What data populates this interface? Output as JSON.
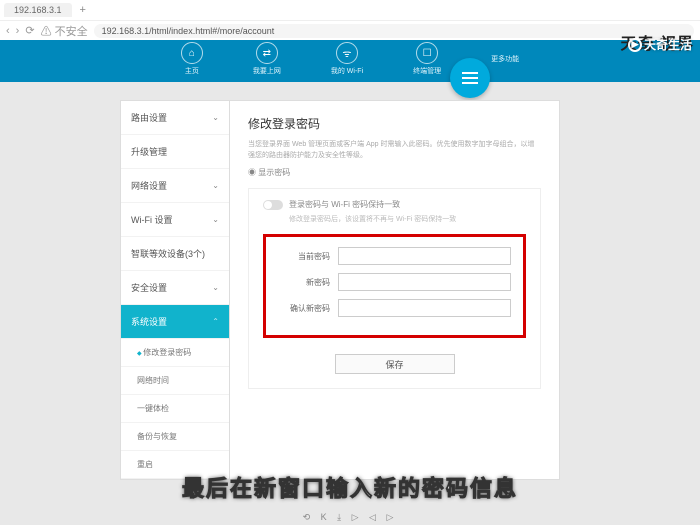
{
  "browser": {
    "tab_title": "192.168.3.1",
    "tab_plus": "+",
    "back": "‹",
    "fwd": "›",
    "reload": "⟳",
    "insecure": "⚠ 不安全",
    "url": "192.168.3.1/html/index.html#/more/account"
  },
  "nav": {
    "items": [
      "主页",
      "我要上网",
      "我的 Wi-Fi",
      "终端管理",
      "更多功能"
    ],
    "icons": [
      "⌂",
      "⇄",
      "ᯤ",
      "☐",
      "⋯"
    ]
  },
  "watermark": {
    "top": "天奇 视界",
    "icon": "▶",
    "text": "天奇生活"
  },
  "sidebar": {
    "items": [
      "路由设置",
      "升级管理",
      "网络设置",
      "Wi-Fi 设置",
      "智联等效设备(3个)",
      "安全设置",
      "系统设置",
      "修改登录密码",
      "网络时间",
      "一键体检",
      "备份与恢复",
      "重启"
    ]
  },
  "panel": {
    "title": "修改登录密码",
    "desc": "当您登录界面 Web 管理页面或客户端 App 时需输入此密码。优先使用数字加字母组合，以增强您的路由器防护能力及安全性等级。",
    "radio": "显示密码",
    "toggle_label": "登录密码与 Wi-Fi 密码保持一致",
    "toggle_sub": "修改登录密码后，该设置将不再与 Wi-Fi 密码保持一致",
    "fields": {
      "current": "当前密码",
      "new": "新密码",
      "confirm": "确认新密码"
    },
    "save": "保存"
  },
  "subtitle": "最后在新窗口输入新的密码信息",
  "video_controls": "⟲ K ⤓ ▷ ◁ ▷"
}
